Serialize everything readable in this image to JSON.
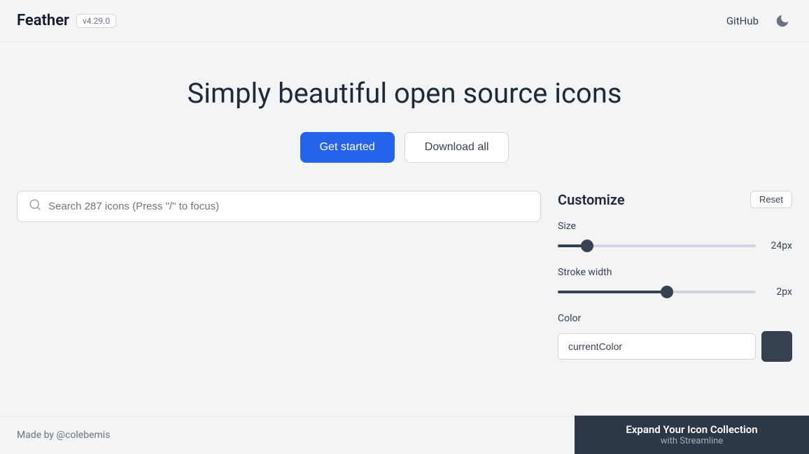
{
  "header": {
    "logo": "Feather",
    "version": "v4.29.0",
    "github_label": "GitHub",
    "moon_icon": "🌙"
  },
  "hero": {
    "title": "Simply beautiful open source icons",
    "get_started_label": "Get started",
    "download_all_label": "Download all"
  },
  "search": {
    "placeholder": "Search 287 icons (Press \"/\" to focus)"
  },
  "customize": {
    "title": "Customize",
    "reset_label": "Reset",
    "size_label": "Size",
    "size_value": "24px",
    "size_thumb_percent": 15,
    "stroke_width_label": "Stroke width",
    "stroke_value": "2px",
    "stroke_thumb_percent": 55,
    "color_label": "Color",
    "color_value": "currentColor"
  },
  "footer": {
    "made_by": "Made by @colebemis",
    "promo_title": "Expand Your Icon Collection",
    "promo_sub": "with Streamline"
  }
}
